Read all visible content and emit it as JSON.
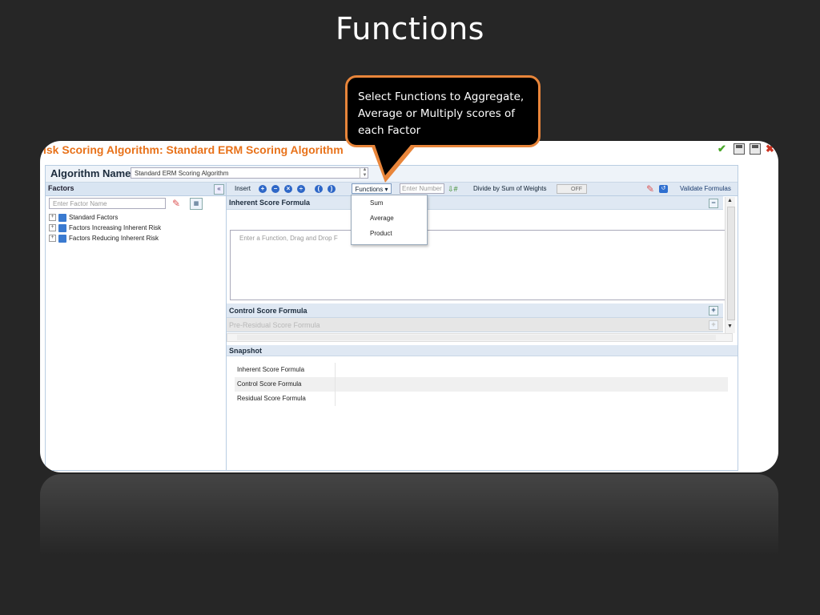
{
  "slide": {
    "title": "Functions"
  },
  "callout": {
    "text": "Select Functions to Aggregate, Average or Multiply scores of each Factor"
  },
  "app": {
    "title": "isk Scoring Algorithm: Standard ERM Scoring Algorithm"
  },
  "algorithm": {
    "label": "Algorithm Name",
    "value": "Standard ERM Scoring Algorithm"
  },
  "factors": {
    "title": "Factors",
    "search_placeholder": "Enter Factor Name",
    "tree": [
      "Standard Factors",
      "Factors Increasing Inherent Risk",
      "Factors Reducing Inherent Risk"
    ]
  },
  "toolbar": {
    "insert": "Insert",
    "functions": "Functions",
    "number_placeholder": "Enter Number",
    "divide": "Divide by Sum of Weights",
    "toggle": "OFF",
    "validate": "Validate Formulas"
  },
  "dropdown": {
    "items": [
      "Sum",
      "Average",
      "Product"
    ]
  },
  "sections": {
    "inherent": "Inherent Score Formula",
    "formula_placeholder": "Enter a Function, Drag and Drop F",
    "control": "Control Score Formula",
    "pre_residual": "Pre-Residual Score Formula",
    "residual_partial": "Residual Score Formula"
  },
  "snapshot": {
    "title": "Snapshot",
    "rows": [
      "Inherent Score Formula",
      "Control Score Formula",
      "Residual Score Formula"
    ]
  }
}
